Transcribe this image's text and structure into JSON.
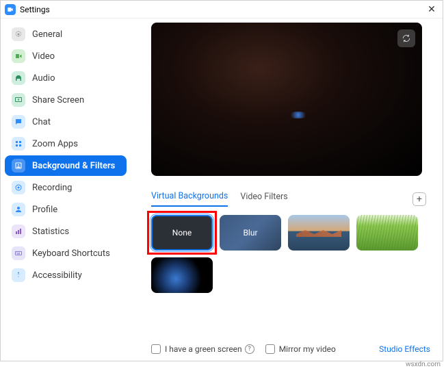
{
  "window": {
    "title": "Settings"
  },
  "sidebar": {
    "items": [
      {
        "label": "General",
        "color": "#e0e0e0",
        "fg": "#888"
      },
      {
        "label": "Video",
        "color": "#e8f4e0",
        "fg": "#4caf50"
      },
      {
        "label": "Audio",
        "color": "#e0f0e8",
        "fg": "#2e9060"
      },
      {
        "label": "Share Screen",
        "color": "#e0f4ea",
        "fg": "#2e9060"
      },
      {
        "label": "Chat",
        "color": "#e0eeff",
        "fg": "#2d8cff"
      },
      {
        "label": "Zoom Apps",
        "color": "#e0f0ff",
        "fg": "#2d8cff"
      },
      {
        "label": "Background & Filters",
        "color": "#ffffff",
        "fg": "#fff"
      },
      {
        "label": "Recording",
        "color": "#e0eeff",
        "fg": "#2d8cff"
      },
      {
        "label": "Profile",
        "color": "#e0eeff",
        "fg": "#2d8cff"
      },
      {
        "label": "Statistics",
        "color": "#f0e8fa",
        "fg": "#8a5cc8"
      },
      {
        "label": "Keyboard Shortcuts",
        "color": "#eae8fa",
        "fg": "#6a5cc8"
      },
      {
        "label": "Accessibility",
        "color": "#e0eeff",
        "fg": "#2d8cff"
      }
    ],
    "active_index": 6
  },
  "tabs": {
    "virtual_backgrounds": "Virtual Backgrounds",
    "video_filters": "Video Filters",
    "active": "virtual_backgrounds"
  },
  "backgrounds": {
    "none_label": "None",
    "blur_label": "Blur",
    "selected": "none"
  },
  "footer": {
    "green_screen": "I have a green screen",
    "mirror": "Mirror my video",
    "studio": "Studio Effects"
  },
  "watermark": "wsxdn.com"
}
